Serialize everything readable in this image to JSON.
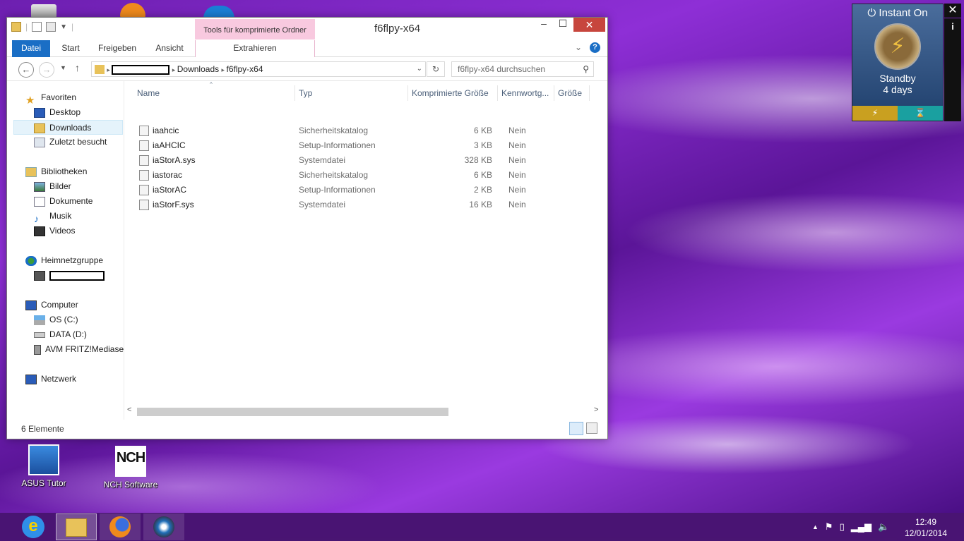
{
  "desktop": {
    "icons": [
      {
        "label": "ASUS Tutor"
      },
      {
        "label": "NCH Software"
      }
    ]
  },
  "window": {
    "title": "f6flpy-x64",
    "context_tab_header": "Tools für komprimierte Ordner",
    "ribbon_tabs": [
      "Datei",
      "Start",
      "Freigeben",
      "Ansicht",
      "Extrahieren"
    ],
    "address": {
      "crumbs": [
        "Downloads",
        "f6flpy-x64"
      ]
    },
    "search_placeholder": "f6flpy-x64 durchsuchen",
    "nav": {
      "favorites": {
        "label": "Favoriten",
        "items": [
          "Desktop",
          "Downloads",
          "Zuletzt besucht"
        ]
      },
      "libraries": {
        "label": "Bibliotheken",
        "items": [
          "Bilder",
          "Dokumente",
          "Musik",
          "Videos"
        ]
      },
      "homegroup": {
        "label": "Heimnetzgruppe"
      },
      "computer": {
        "label": "Computer",
        "items": [
          "OS (C:)",
          "DATA (D:)",
          "AVM FRITZ!Mediase"
        ]
      },
      "network": {
        "label": "Netzwerk"
      }
    },
    "columns": [
      "Name",
      "Typ",
      "Komprimierte Größe",
      "Kennwortg...",
      "Größe"
    ],
    "files": [
      {
        "name": "iaahcic",
        "type": "Sicherheitskatalog",
        "csize": "6 KB",
        "pw": "Nein",
        "icon": "catalog-icon"
      },
      {
        "name": "iaAHCIC",
        "type": "Setup-Informationen",
        "csize": "3 KB",
        "pw": "Nein",
        "icon": "setup-info-icon"
      },
      {
        "name": "iaStorA.sys",
        "type": "Systemdatei",
        "csize": "328 KB",
        "pw": "Nein",
        "icon": "system-file-icon"
      },
      {
        "name": "iastorac",
        "type": "Sicherheitskatalog",
        "csize": "6 KB",
        "pw": "Nein",
        "icon": "catalog-icon"
      },
      {
        "name": "iaStorAC",
        "type": "Setup-Informationen",
        "csize": "2 KB",
        "pw": "Nein",
        "icon": "setup-info-icon"
      },
      {
        "name": "iaStorF.sys",
        "type": "Systemdatei",
        "csize": "16 KB",
        "pw": "Nein",
        "icon": "system-file-icon"
      }
    ],
    "status": "6 Elemente"
  },
  "widget": {
    "title": "Instant On",
    "state": "Standby",
    "duration": "4 days"
  },
  "taskbar": {
    "time": "12:49",
    "date": "12/01/2014"
  }
}
